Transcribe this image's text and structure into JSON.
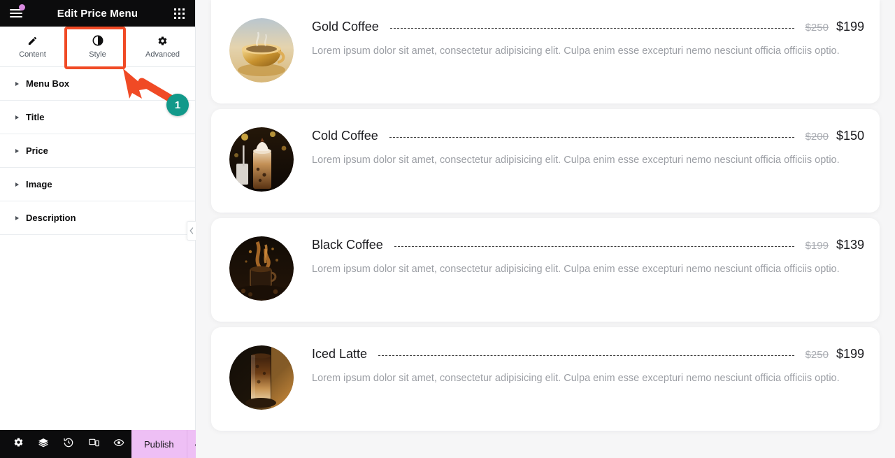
{
  "panel": {
    "header": {
      "title": "Edit Price Menu",
      "menu_icon": "hamburger-icon",
      "notification_dot": true,
      "apps_icon": "apps-grid-icon"
    },
    "tabs": [
      {
        "label": "Content",
        "icon": "pencil-icon",
        "active": false
      },
      {
        "label": "Style",
        "icon": "contrast-icon",
        "active": true
      },
      {
        "label": "Advanced",
        "icon": "gear-icon",
        "active": false
      }
    ],
    "sections": [
      {
        "label": "Menu Box"
      },
      {
        "label": "Title"
      },
      {
        "label": "Price"
      },
      {
        "label": "Image"
      },
      {
        "label": "Description"
      }
    ],
    "footer": {
      "tools": [
        {
          "name": "settings-icon",
          "title": "Settings"
        },
        {
          "name": "layers-icon",
          "title": "Navigator"
        },
        {
          "name": "history-icon",
          "title": "History"
        },
        {
          "name": "responsive-icon",
          "title": "Responsive Mode"
        },
        {
          "name": "preview-icon",
          "title": "Preview Changes"
        }
      ],
      "publish_label": "Publish",
      "publish_arrow_icon": "chevron-up-icon"
    },
    "collapse_handle_icon": "chevron-left-icon"
  },
  "annotation": {
    "badge_number": "1",
    "highlight_target": "Style",
    "arrow_color": "#f04a25",
    "badge_color": "#12998a"
  },
  "canvas": {
    "items": [
      {
        "title": "Gold Coffee",
        "old_price": "$250",
        "new_price": "$199",
        "description": "Lorem ipsum dolor sit amet, consectetur adipisicing elit. Culpa enim esse excepturi nemo nesciunt officia officiis optio.",
        "image": "gold-coffee-cup"
      },
      {
        "title": "Cold Coffee",
        "old_price": "$200",
        "new_price": "$150",
        "description": "Lorem ipsum dolor sit amet, consectetur adipisicing elit. Culpa enim esse excepturi nemo nesciunt officia officiis optio.",
        "image": "iced-whipped-coffee"
      },
      {
        "title": "Black Coffee",
        "old_price": "$199",
        "new_price": "$139",
        "description": "Lorem ipsum dolor sit amet, consectetur adipisicing elit. Culpa enim esse excepturi nemo nesciunt officia officiis optio.",
        "image": "black-coffee-splash"
      },
      {
        "title": "Iced Latte",
        "old_price": "$250",
        "new_price": "$199",
        "description": "Lorem ipsum dolor sit amet, consectetur adipisicing elit. Culpa enim esse excepturi nemo nesciunt officia officiis optio.",
        "image": "iced-latte-glass"
      }
    ]
  },
  "colors": {
    "panel_header_bg": "#0c0c0d",
    "publish_bg": "#eebff5",
    "canvas_bg": "#f6f6f7",
    "accent_highlight": "#f04a25",
    "badge": "#12998a",
    "notification_dot": "#d98ae0"
  }
}
